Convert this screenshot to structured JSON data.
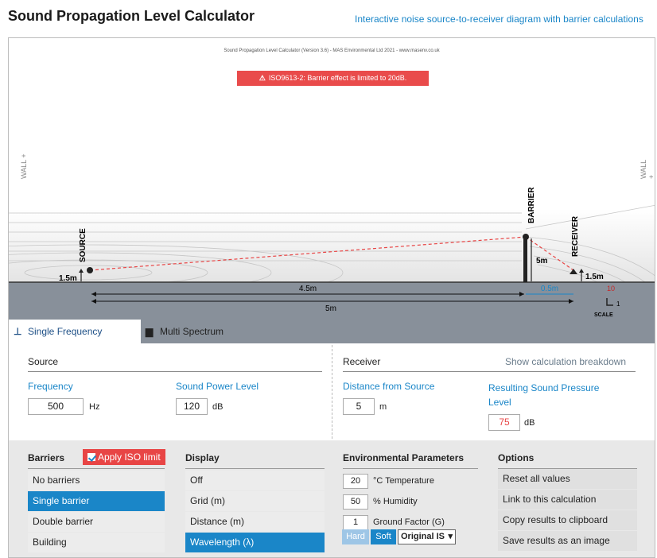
{
  "header": {
    "title": "Sound Propagation Level Calculator",
    "subtitle": "Interactive noise source-to-receiver diagram with barrier calculations"
  },
  "diagram": {
    "credit": "Sound Propagation Level Calculator (Version 3.6) - MAS Environmental Ltd 2021 - www.masenv.co.uk",
    "warning": "ISO9613-2: Barrier effect is limited to 20dB.",
    "wall_left": "WALL +",
    "wall_right": "WALL +",
    "source_label": "SOURCE",
    "barrier_label": "BARRIER",
    "receiver_label": "RECEIVER",
    "source_height": "1.5m",
    "barrier_height": "5m",
    "receiver_height": "1.5m",
    "dist_source_barrier": "4.5m",
    "dist_barrier_receiver": "0.5m",
    "dist_total": "5m",
    "scale_value": "10",
    "scale_small": "1",
    "scale_label": "SCALE"
  },
  "tabs": [
    {
      "label": "Single Frequency",
      "active": true
    },
    {
      "label": "Multi Spectrum",
      "active": false
    }
  ],
  "source": {
    "heading": "Source",
    "freq_label": "Frequency",
    "freq_value": "500",
    "freq_unit": "Hz",
    "swl_label": "Sound Power Level",
    "swl_value": "120",
    "swl_unit": "dB"
  },
  "receiver": {
    "heading": "Receiver",
    "breakdown_link": "Show calculation breakdown",
    "dist_label": "Distance from Source",
    "dist_value": "5",
    "dist_unit": "m",
    "spl_label": "Resulting Sound Pressure Level",
    "spl_value": "75",
    "spl_unit": "dB"
  },
  "barriers": {
    "heading": "Barriers",
    "iso_button": "Apply ISO limit",
    "items": [
      "No barriers",
      "Single barrier",
      "Double barrier",
      "Building"
    ],
    "selected": "Single barrier"
  },
  "display": {
    "heading": "Display",
    "items": [
      "Off",
      "Grid (m)",
      "Distance (m)",
      "Wavelength (λ)"
    ],
    "selected": "Wavelength (λ)"
  },
  "environment": {
    "heading": "Environmental Parameters",
    "temp_value": "20",
    "temp_label": "°C Temperature",
    "humidity_value": "50",
    "humidity_label": "% Humidity",
    "ground_value": "1",
    "ground_label": "Ground Factor (G)",
    "hard_label": "Hard",
    "soft_label": "Soft",
    "select_value": "Original IS"
  },
  "options": {
    "heading": "Options",
    "items": [
      "Reset all values",
      "Link to this calculation",
      "Copy results to clipboard",
      "Save results as an image"
    ]
  },
  "colors": {
    "accent": "#1a86c8",
    "warning": "#e94b4b",
    "ground": "#88909a"
  }
}
